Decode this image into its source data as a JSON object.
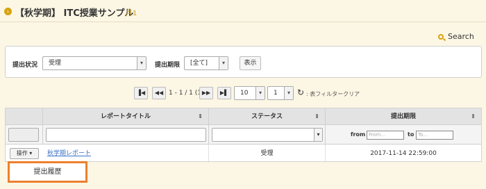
{
  "header": {
    "title": "【秋学期】 ITC授業サンプル",
    "sub": "月1"
  },
  "search": {
    "label": "Search"
  },
  "filter": {
    "status_label": "提出状況",
    "status_value": "受理",
    "deadline_label": "提出期限",
    "deadline_value": "[全て]",
    "show_button": "表示"
  },
  "pager": {
    "info": "1 - 1 / 1 (1)",
    "per_page": "10",
    "page": "1",
    "clear_filter": ": 表フィルタークリア"
  },
  "table": {
    "columns": [
      "レポートタイトル",
      "ステータス",
      "提出期限"
    ],
    "from_label": "from",
    "to_label": "to",
    "from_placeholder": "From...",
    "to_placeholder": "To...",
    "row": {
      "op_label": "操作",
      "title": "秋学期レポート",
      "status": "受理",
      "deadline": "2017-11-14 22:59:00"
    }
  },
  "dropdown": {
    "item": "提出履歴"
  }
}
